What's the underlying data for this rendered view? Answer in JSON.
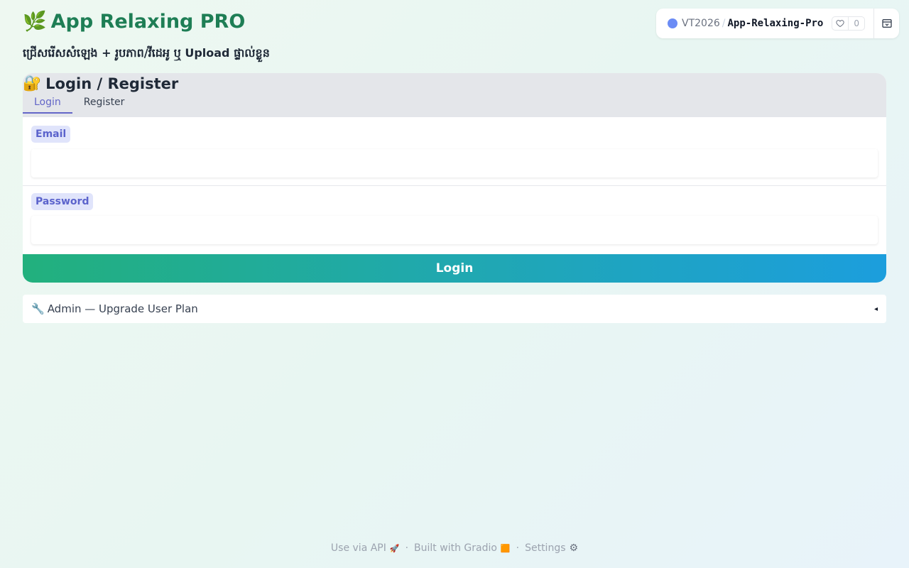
{
  "header": {
    "title_icon": "🌿",
    "title": "App Relaxing PRO",
    "subtitle": "ជ្រើសរើសសំឡេង + រូបភាព/វីដេអូ ឬ Upload ផ្ទាល់ខ្លួន"
  },
  "space_badge": {
    "owner": "VT2026",
    "separator": "/",
    "space_name": "App-Relaxing-Pro",
    "likes": "0"
  },
  "auth_card": {
    "title_icon": "🔐",
    "title": "Login / Register",
    "tabs": [
      {
        "label": "Login",
        "active": true
      },
      {
        "label": "Register",
        "active": false
      }
    ],
    "email_label": "Email",
    "email_value": "",
    "password_label": "Password",
    "password_value": "",
    "login_button": "Login"
  },
  "admin_accordion": {
    "icon": "🔧",
    "label": "Admin — Upgrade User Plan",
    "arrow": "◂"
  },
  "footer": {
    "api_label": "Use via API",
    "api_icon": "🚀",
    "built_label": "Built with Gradio",
    "built_icon": "🟧",
    "settings_label": "Settings",
    "settings_icon": "⚙"
  },
  "colors": {
    "title_green": "#1e7e55",
    "accent_purple": "#6366c8",
    "button_gradient_start": "#22b07d",
    "button_gradient_end": "#1c9edd"
  }
}
